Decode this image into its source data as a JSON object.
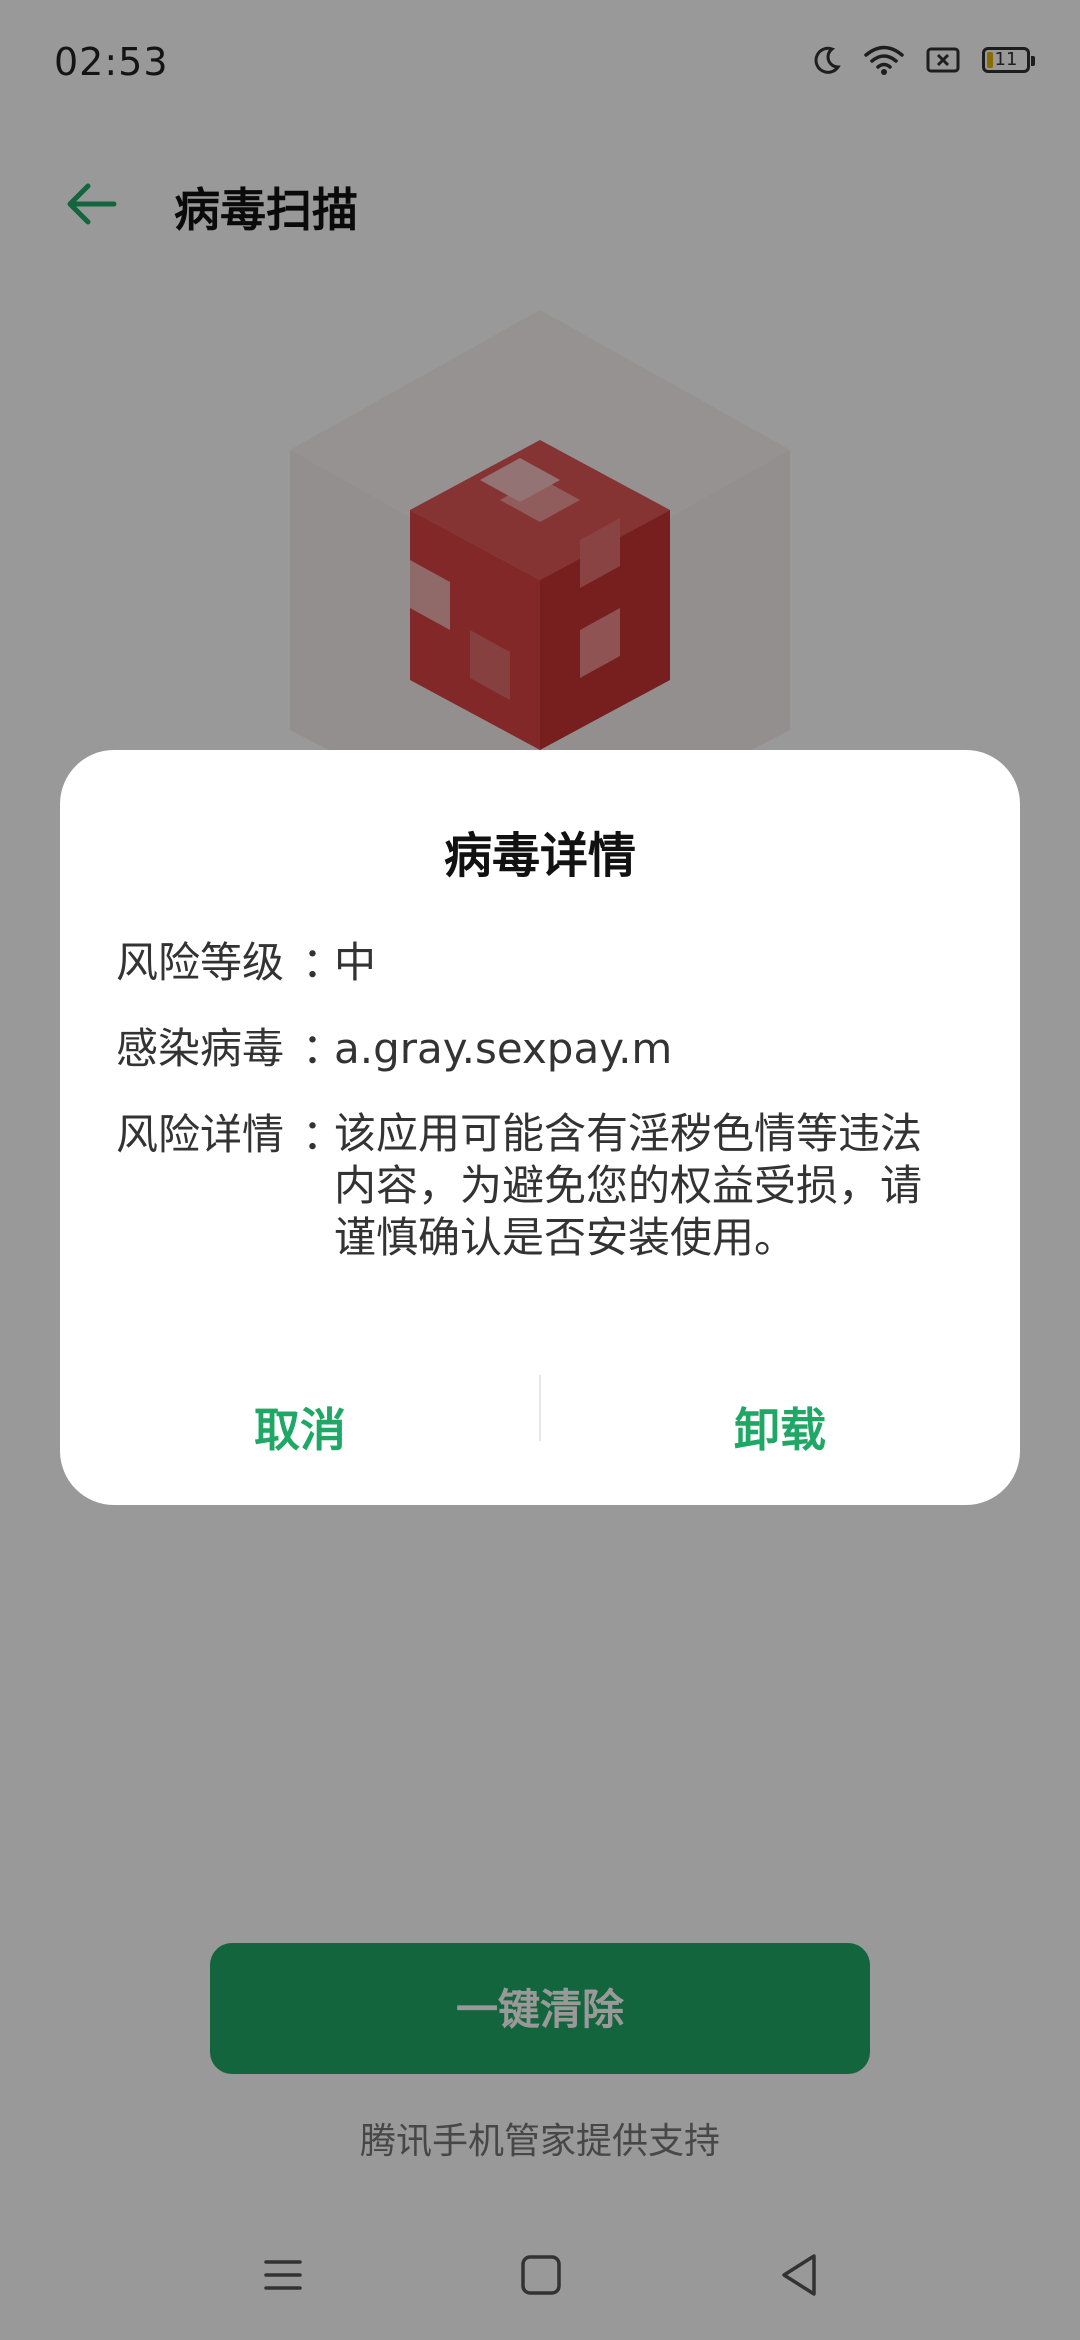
{
  "status_bar": {
    "time": "02:53",
    "icons": [
      "moon-icon",
      "wifi-icon",
      "sim-off-icon",
      "battery-icon"
    ],
    "battery_level": "11"
  },
  "appbar": {
    "back_icon": "back-arrow-icon",
    "title": "病毒扫描",
    "accent_color": "#1fa865"
  },
  "main": {
    "hero_icon": "red-cube-icon",
    "clean_button_label": "一键清除",
    "support_text": "腾讯手机管家提供支持"
  },
  "dialog": {
    "title": "病毒详情",
    "rows": [
      {
        "label": "风险等级",
        "colon": "：",
        "value": "中"
      },
      {
        "label": "感染病毒",
        "colon": "：",
        "value": "a.gray.sexpay.m"
      },
      {
        "label": "风险详情",
        "colon": "：",
        "value": "该应用可能含有淫秽色情等违法内容，为避免您的权益受损，请谨慎确认是否安装使用。"
      }
    ],
    "cancel_label": "取消",
    "uninstall_label": "卸载"
  },
  "nav_bar": {
    "icons": [
      "menu-icon",
      "home-icon",
      "back-triangle-icon"
    ]
  }
}
